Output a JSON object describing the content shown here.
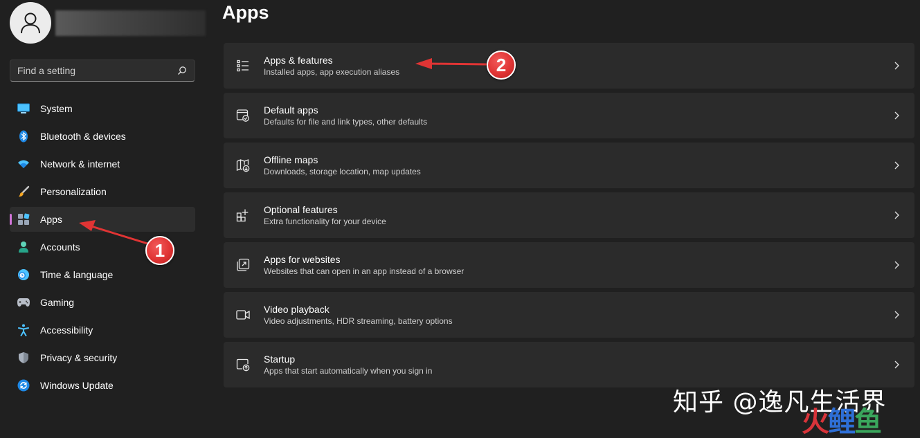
{
  "sidebar": {
    "search_placeholder": "Find a setting",
    "items": [
      {
        "label": "System",
        "icon": "monitor-icon"
      },
      {
        "label": "Bluetooth & devices",
        "icon": "bluetooth-icon"
      },
      {
        "label": "Network & internet",
        "icon": "wifi-icon"
      },
      {
        "label": "Personalization",
        "icon": "paintbrush-icon"
      },
      {
        "label": "Apps",
        "icon": "apps-icon",
        "active": true
      },
      {
        "label": "Accounts",
        "icon": "person-icon"
      },
      {
        "label": "Time & language",
        "icon": "clock-globe-icon"
      },
      {
        "label": "Gaming",
        "icon": "gamepad-icon"
      },
      {
        "label": "Accessibility",
        "icon": "accessibility-icon"
      },
      {
        "label": "Privacy & security",
        "icon": "shield-icon"
      },
      {
        "label": "Windows Update",
        "icon": "update-icon"
      }
    ]
  },
  "main": {
    "title": "Apps",
    "cards": [
      {
        "title": "Apps & features",
        "subtitle": "Installed apps, app execution aliases",
        "icon": "list-icon"
      },
      {
        "title": "Default apps",
        "subtitle": "Defaults for file and link types, other defaults",
        "icon": "default-apps-icon"
      },
      {
        "title": "Offline maps",
        "subtitle": "Downloads, storage location, map updates",
        "icon": "map-download-icon"
      },
      {
        "title": "Optional features",
        "subtitle": "Extra functionality for your device",
        "icon": "add-grid-icon"
      },
      {
        "title": "Apps for websites",
        "subtitle": "Websites that can open in an app instead of a browser",
        "icon": "open-external-icon"
      },
      {
        "title": "Video playback",
        "subtitle": "Video adjustments, HDR streaming, battery options",
        "icon": "video-camera-icon"
      },
      {
        "title": "Startup",
        "subtitle": "Apps that start automatically when you sign in",
        "icon": "startup-icon"
      }
    ]
  },
  "annotations": {
    "step1": "1",
    "step2": "2",
    "color": "#e03434"
  },
  "watermark": {
    "text": "知乎 @逸凡生活界",
    "logo_1": "火",
    "logo_2": "鲤",
    "logo_3": "鱼"
  },
  "colors": {
    "background": "#202020",
    "card": "#2b2b2b",
    "accent": "#d175d9"
  }
}
